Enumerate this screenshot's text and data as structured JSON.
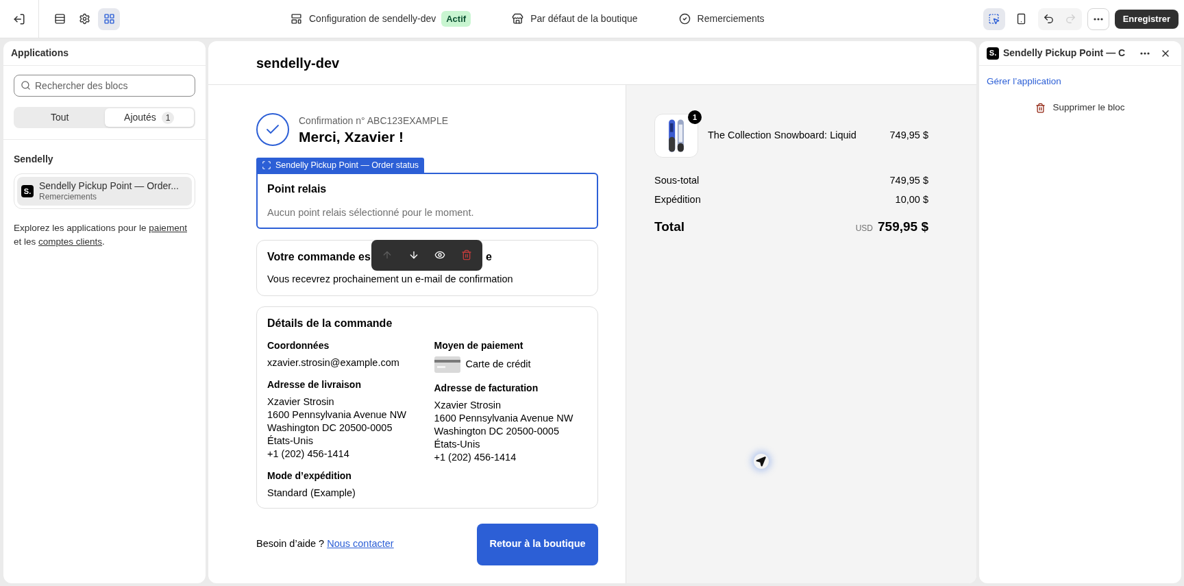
{
  "top_bar": {
    "nav_icons": [
      {
        "kind": "sections",
        "selected": false
      },
      {
        "kind": "settings",
        "selected": false
      },
      {
        "kind": "apps",
        "selected": true
      }
    ],
    "page_tabs": [
      {
        "kind": "config",
        "label": "Configuration de sendelly-dev",
        "badge": "Actif"
      },
      {
        "kind": "store",
        "label": "Par défaut de la boutique"
      },
      {
        "kind": "check",
        "label": "Remerciements"
      }
    ],
    "view_tools": [
      {
        "kind": "select",
        "selected": true
      },
      {
        "kind": "mobile",
        "selected": false
      }
    ],
    "history": [
      {
        "kind": "undo",
        "disabled": false
      },
      {
        "kind": "redo",
        "disabled": true
      }
    ],
    "save_button": "Enregistrer"
  },
  "sidebar": {
    "title": "Applications",
    "search": {
      "placeholder": "Rechercher des blocs"
    },
    "segments": [
      {
        "label": "Tout",
        "selected": false
      },
      {
        "label": "Ajoutés",
        "count": "1",
        "selected": true
      }
    ],
    "group": "Sendelly",
    "apps": [
      {
        "logo": "S.",
        "title": "Sendelly Pickup Point — Order...",
        "subtitle": "Remerciements",
        "selected": true
      }
    ],
    "explore": [
      {
        "text": "Explorez les applications pour le "
      },
      {
        "text": "paiement",
        "link": true
      },
      {
        "text": " et les "
      },
      {
        "text": "comptes clients",
        "link": true
      },
      {
        "text": "."
      }
    ]
  },
  "preview": {
    "store_name": "sendelly-dev",
    "confirmation": "Confirmation n° ABC123EXAMPLE",
    "greeting": "Merci, Xzavier !",
    "block_label": "Sendelly Pickup Point — Order status",
    "pickup": {
      "title": "Point relais",
      "text": "Aucun point relais sélectionné pour le moment."
    },
    "block_toolbar": [
      {
        "kind": "up",
        "disabled": true
      },
      {
        "kind": "down",
        "disabled": false
      },
      {
        "kind": "visibility",
        "disabled": false
      },
      {
        "kind": "delete",
        "disabled": false
      }
    ],
    "status": {
      "title_parts": [
        "Votre commande es",
        "e"
      ],
      "text": "Vous recevrez prochainement un e-mail de confirmation"
    },
    "details": {
      "title": "Détails de la commande",
      "columns": [
        [
          {
            "kind": "lines",
            "title": "Coordonnées",
            "lines": [
              "xzavier.strosin@example.com"
            ]
          },
          {
            "kind": "lines",
            "title": "Adresse de livraison",
            "lines": [
              "Xzavier Strosin",
              "1600 Pennsylvania Avenue NW",
              "Washington DC 20500-0005",
              "États-Unis",
              "+1 (202) 456-1414"
            ]
          },
          {
            "kind": "lines",
            "title": "Mode d’expédition",
            "lines": [
              "Standard (Example)"
            ]
          }
        ],
        [
          {
            "kind": "payment",
            "title": "Moyen de paiement",
            "lines": [
              "Carte de crédit"
            ]
          },
          {
            "kind": "lines",
            "title": "Adresse de facturation",
            "lines": [
              "Xzavier Strosin",
              "1600 Pennsylvania Avenue NW",
              "Washington DC 20500-0005",
              "États-Unis",
              "+1 (202) 456-1414"
            ]
          }
        ]
      ]
    },
    "help": "Besoin d’aide ?",
    "contact_link": "Nous contacter",
    "return_button": "Retour à la boutique",
    "summary": {
      "items": [
        {
          "kind": "picture",
          "name": "The Collection Snowboard: Liquid",
          "price": "749,95 $",
          "quantity": "1"
        }
      ],
      "rows": [
        {
          "label": "Sous-total",
          "value": "749,95 $"
        },
        {
          "label": "Expédition",
          "value": "10,00 $"
        }
      ],
      "total": {
        "label": "Total",
        "currency": "USD",
        "value": "759,95 $"
      }
    }
  },
  "inspector": {
    "logo": "S.",
    "title": "Sendelly Pickup Point — C",
    "manage_link": "Gérer l’application",
    "delete_button": "Supprimer le bloc"
  }
}
